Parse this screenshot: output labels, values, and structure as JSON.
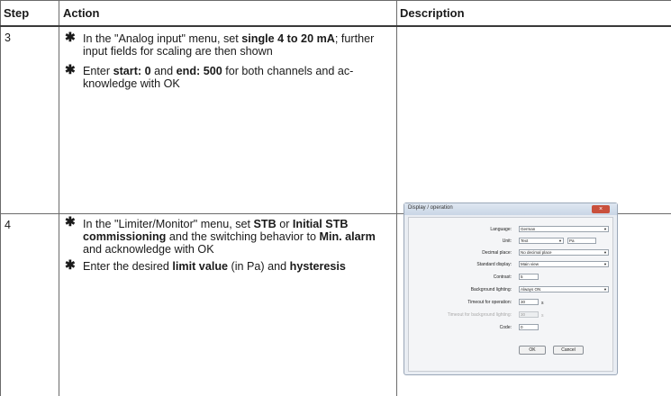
{
  "table": {
    "headers": {
      "step": "Step",
      "action": "Action",
      "description": "Description"
    },
    "rows": [
      {
        "step": "3",
        "bullets": [
          {
            "marker": "✱",
            "lines": [
              "In the \"Analog input\" menu, set <b>single 4 to 20 mA</b>; further",
              "input fields for scaling are then shown"
            ]
          },
          {
            "marker": "✱",
            "lines": [
              "Enter <b>start: 0</b> and <b>end: 500</b> for both channels and ac-",
              "knowledge with OK"
            ]
          }
        ]
      },
      {
        "step": "4",
        "bullets": [
          {
            "marker": "✱",
            "lines": [
              "In the \"Limiter/Monitor\" menu, set <b>STB</b> or <b>Initial STB</b>",
              "<b>commissioning</b> and the switching behavior to <b>Min. alarm</b>",
              "and acknowledge with OK"
            ]
          },
          {
            "marker": "✱",
            "lines": [
              "Enter the desired <b>limit value</b> (in Pa) and <b>hysteresis</b>"
            ]
          }
        ]
      }
    ]
  },
  "dialog": {
    "title": "Display / operation",
    "close_symbol": "×",
    "fields": {
      "language": {
        "label": "Language:",
        "value": "German"
      },
      "unit": {
        "label": "Unit:",
        "value": "Text",
        "extra": "Pa"
      },
      "decimal_place": {
        "label": "Decimal place:",
        "value": "No decimal place"
      },
      "standard_display": {
        "label": "Standard display:",
        "value": "Main view"
      },
      "contrast": {
        "label": "Contrast:",
        "value": "5"
      },
      "background_lighting": {
        "label": "Background lighting:",
        "value": "Always ON"
      },
      "timeout_operation": {
        "label": "Timeout for operation:",
        "value": "30",
        "unit": "s"
      },
      "timeout_background": {
        "label": "Timeout for background lighting:",
        "value": "30",
        "unit": "s"
      },
      "code": {
        "label": "Code:",
        "value": "0"
      }
    },
    "ok_label": "OK",
    "cancel_label": "Cancel",
    "dropdown_arrow": "▼"
  }
}
